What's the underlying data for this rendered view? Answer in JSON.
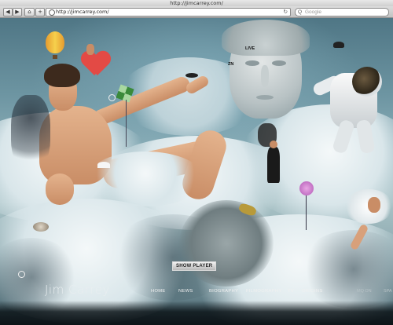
{
  "browser": {
    "title": "http://jimcarrey.com/",
    "back_glyph": "◀",
    "forward_glyph": "▶",
    "home_glyph": "⌂",
    "add_glyph": "+",
    "url": "http://jimcarrey.com/",
    "reload_glyph": "↻",
    "search_placeholder": "Google",
    "search_glyph": "Q"
  },
  "page": {
    "statue_labels": {
      "live": "LIVE",
      "zn": "ZN"
    },
    "show_player_label": "SHOW PLAYER",
    "logo": "Jim Carrey",
    "nav": [
      "HOME",
      "NEWS",
      "BIOGRAPHY",
      "FILMOGRAPHY",
      "TV",
      "ORIGINS"
    ],
    "footer_right": [
      "MQ ON",
      "SPA"
    ]
  },
  "colors": {
    "sky": "#6d95a2",
    "cloud": "#f4f8f9",
    "bottom_bar": "#0d1418",
    "heart": "#e34a45",
    "balloon": "#f6d04c"
  },
  "icons": [
    "back-icon",
    "forward-icon",
    "home-icon",
    "add-tab-icon",
    "favicon-icon",
    "reload-icon",
    "search-icon",
    "ring-icon"
  ]
}
